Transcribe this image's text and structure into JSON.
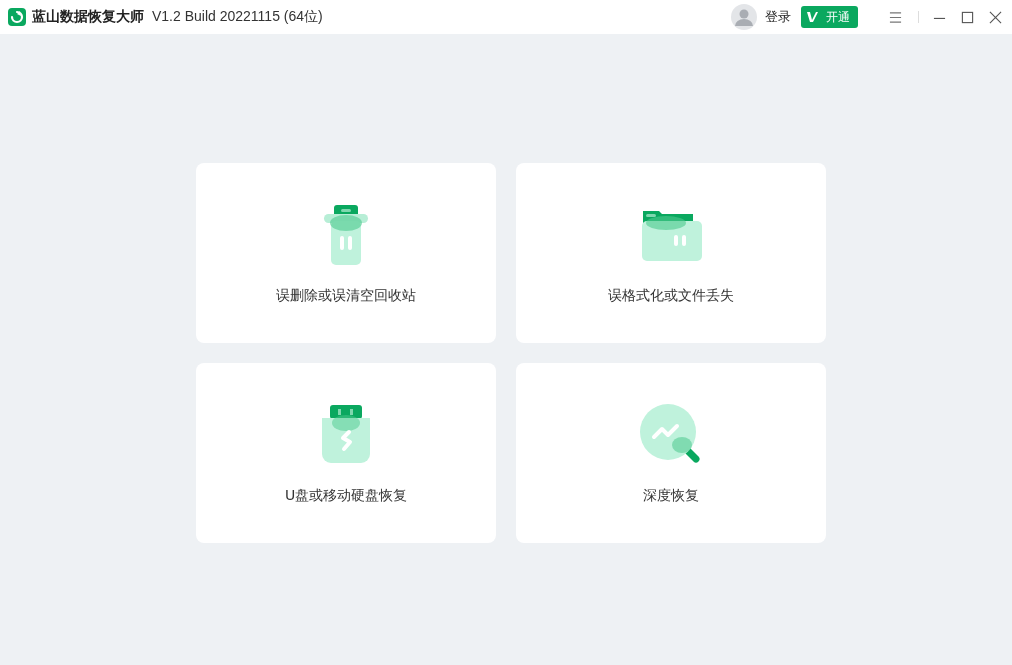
{
  "window": {
    "title": "蓝山数据恢复大师",
    "version": "V1.2 Build 20221115 (64位)"
  },
  "account": {
    "login": "登录",
    "vip_label": "开通"
  },
  "cards": [
    {
      "kind": "trash",
      "label": "误删除或误清空回收站"
    },
    {
      "kind": "folder",
      "label": "误格式化或文件丢失"
    },
    {
      "kind": "usb",
      "label": "U盘或移动硬盘恢复"
    },
    {
      "kind": "deep",
      "label": "深度恢复"
    }
  ]
}
